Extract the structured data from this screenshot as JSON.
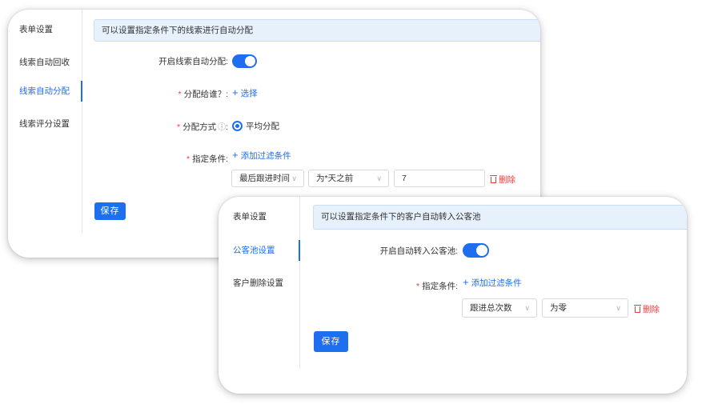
{
  "card1": {
    "sidebar": {
      "items": [
        {
          "label": "表单设置"
        },
        {
          "label": "线索自动回收"
        },
        {
          "label": "线索自动分配"
        },
        {
          "label": "线索评分设置"
        }
      ],
      "active_index": 2
    },
    "banner": "可以设置指定条件下的线索进行自动分配",
    "auto_assign_label": "开启线索自动分配:",
    "auto_assign_enabled": true,
    "assign_to_label": "分配给谁？:",
    "assign_to_link": "选择",
    "assign_method_label": "分配方式",
    "assign_method_option": "平均分配",
    "condition_label": "指定条件:",
    "add_filter": "添加过滤条件",
    "filter": {
      "field": "最后跟进时间",
      "operator": "为*天之前",
      "value": "7",
      "delete": "删除"
    },
    "save": "保存"
  },
  "card2": {
    "sidebar": {
      "items": [
        {
          "label": "表单设置"
        },
        {
          "label": "公客池设置"
        },
        {
          "label": "客户删除设置"
        }
      ],
      "active_index": 1
    },
    "banner": "可以设置指定条件下的客户自动转入公客池",
    "auto_pool_label": "开启自动转入公客池:",
    "auto_pool_enabled": true,
    "condition_label": "指定条件:",
    "add_filter": "添加过滤条件",
    "filter": {
      "field": "跟进总次数",
      "operator": "为零",
      "delete": "删除"
    },
    "save": "保存"
  },
  "colors": {
    "primary": "#1e6ef0",
    "danger": "#f23c3c",
    "banner_bg": "#e6f1fc"
  }
}
